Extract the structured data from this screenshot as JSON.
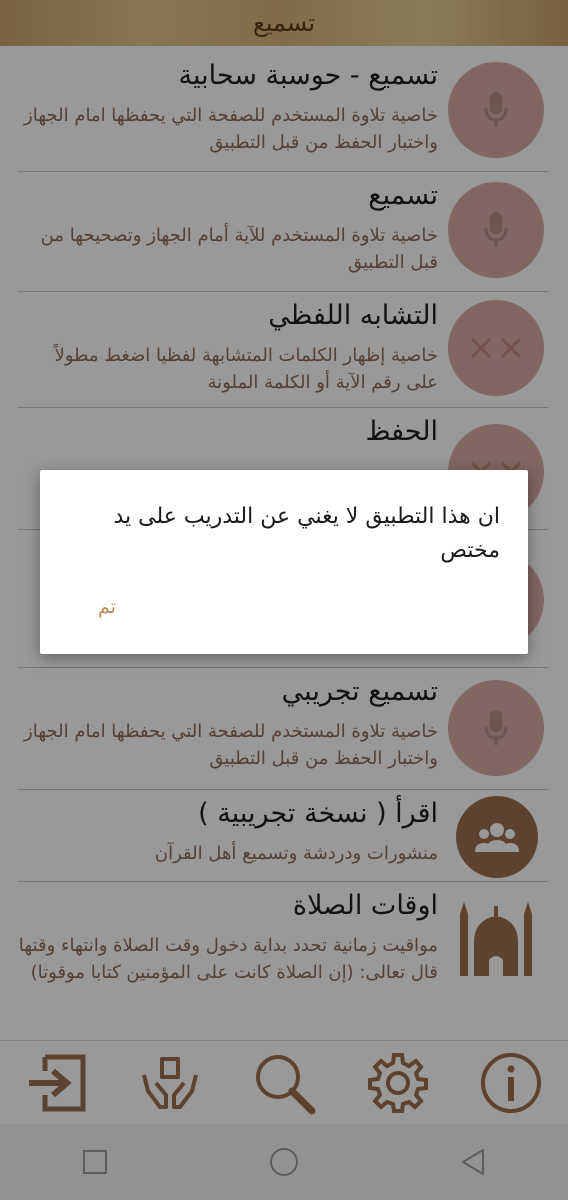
{
  "header": {
    "title": "تسميع"
  },
  "list": {
    "items": [
      {
        "title": "تسميع - حوسبة سحابية",
        "description": "خاصية تلاوة المستخدم للصفحة التي يحفظها امام الجهاز واختبار الحفظ من قبل التطبيق",
        "icon": "microphone-icon"
      },
      {
        "title": "تسميع",
        "description": "خاصية تلاوة المستخدم للآية أمام الجهاز وتصحيحها من قبل التطبيق",
        "icon": "microphone-icon"
      },
      {
        "title": "التشابه اللفظي",
        "description": "خاصية إظهار الكلمات المتشابهة لفظيا اضغط مطولاً على رقم الآية أو الكلمة الملونة",
        "icon": "cross-marks-icon"
      },
      {
        "title": "الحفظ",
        "description": "",
        "icon": "cross-marks-icon"
      },
      {
        "title": "",
        "description": "",
        "icon": "microphone-icon"
      },
      {
        "title": "تسميع تجريبي",
        "description": "خاصية تلاوة المستخدم للصفحة التي يحفظها امام الجهاز واختبار الحفظ من قبل التطبيق",
        "icon": "microphone-icon"
      },
      {
        "title": "اقرأ ( نسخة تجريبية )",
        "description": "منشورات ودردشة وتسميع أهل القرآن",
        "icon": "community-icon"
      },
      {
        "title": "اوقات الصلاة",
        "description": "مواقيت زمانية تحدد بداية دخول وقت الصلاة وانتهاء وقتها قال تعالى: (إن الصلاة كانت على المؤمنين كتابا موقوتا)",
        "icon": "mosque-icon"
      }
    ]
  },
  "bottom_bar": {
    "icons": [
      "info-icon",
      "settings-gear-icon",
      "search-icon",
      "quran-hands-icon",
      "login-icon"
    ]
  },
  "nav": {
    "icons": [
      "recent-apps-icon",
      "home-icon",
      "back-icon"
    ]
  },
  "dialog": {
    "message": "ان هذا التطبيق لا يغني عن التدريب على يد مختص",
    "ok_label": "تم"
  },
  "colors": {
    "header_bg": "#d8b47b",
    "icon_bg": "#d8aaa3",
    "brown": "#9a6e4f",
    "accent_text": "#8a6a57"
  }
}
